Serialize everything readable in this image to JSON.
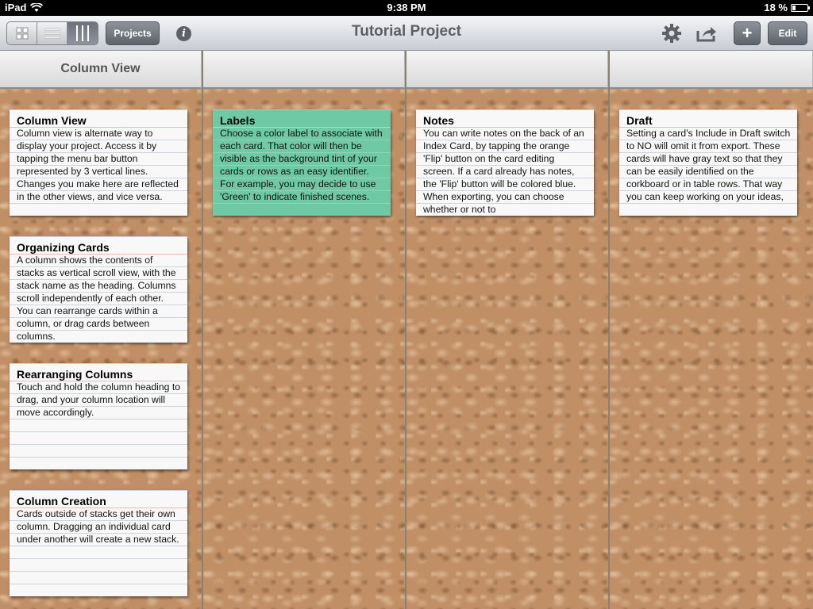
{
  "status": {
    "device": "iPad",
    "time": "9:38 PM",
    "battery": "18 %",
    "battery_fraction": 0.18
  },
  "toolbar": {
    "projects_label": "Projects",
    "title": "Tutorial Project",
    "edit_label": "Edit",
    "add_label": "+",
    "info_label": "i"
  },
  "columns": [
    {
      "heading": "Column View",
      "cards": [
        {
          "title": "Column View",
          "body": "Column view is alternate way to display your project. Access it by tapping the menu bar button represented by 3 vertical lines. Changes you make here are reflected in the other views, and vice versa."
        },
        {
          "title": "Organizing Cards",
          "body": "A column shows the contents of stacks as vertical scroll view, with the stack name as the heading. Columns scroll independently of each other. You can rearrange cards within a column, or drag cards between columns."
        },
        {
          "title": "Rearranging Columns",
          "body": "Touch and hold the column heading to drag, and your column location will move accordingly."
        },
        {
          "title": "Column Creation",
          "body": "Cards outside of stacks get their own column. Dragging an individual card under another will create a new stack."
        }
      ]
    },
    {
      "heading": "",
      "cards": [
        {
          "title": "Labels",
          "body": "Choose a color label to associate with each card. That color will then be visible as the background tint of your cards or rows as an easy identifier. For example, you may decide to use 'Green' to indicate finished scenes.",
          "color": "#6ec9a4"
        }
      ]
    },
    {
      "heading": "",
      "cards": [
        {
          "title": "Notes",
          "body": "You can write notes on the back of an Index Card, by tapping the orange 'Flip' button on the card editing screen. If a card already has notes, the 'Flip' button will be colored blue. When exporting, you can choose whether or not to"
        }
      ]
    },
    {
      "heading": "",
      "cards": [
        {
          "title": "Draft",
          "body": "Setting a card's Include in Draft switch to NO will omit it from export. These cards will have gray text so that they can be easily identified on the corkboard or in table rows. That way you can keep working on your ideas,"
        }
      ]
    }
  ]
}
